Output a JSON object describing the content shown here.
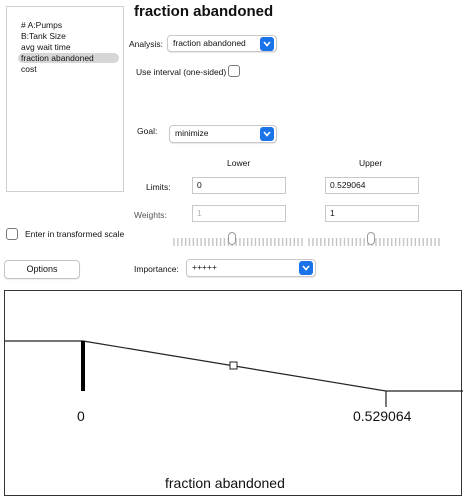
{
  "title": "fraction abandoned",
  "factors": {
    "items": [
      {
        "label": "# A:Pumps",
        "selected": false
      },
      {
        "label": "B:Tank Size",
        "selected": false
      },
      {
        "label": "avg wait time",
        "selected": false
      },
      {
        "label": "fraction abandoned",
        "selected": true
      },
      {
        "label": "cost",
        "selected": false
      }
    ]
  },
  "analysis": {
    "label": "Analysis:",
    "value": "fraction abandoned"
  },
  "use_interval": {
    "label": "Use interval (one-sided)",
    "checked": false
  },
  "goal": {
    "label": "Goal:",
    "value": "minimize"
  },
  "columns": {
    "lower": "Lower",
    "upper": "Upper"
  },
  "limits": {
    "label": "Limits:",
    "lower": "0",
    "upper": "0.529064"
  },
  "weights": {
    "label": "Weights:",
    "lower": "1",
    "upper": "1"
  },
  "sliders": {
    "lower_weight_position": 0.45,
    "upper_weight_position": 0.48
  },
  "transformed": {
    "label": "Enter in transformed scale",
    "checked": false
  },
  "options": {
    "label": "Options"
  },
  "importance": {
    "label": "Importance:",
    "value": "+++++"
  },
  "plot": {
    "xmin": "0",
    "xmax": "0.529064",
    "xlabel": "fraction abandoned",
    "colors": {
      "line": "#222222",
      "accent": "#1a73e8"
    }
  }
}
